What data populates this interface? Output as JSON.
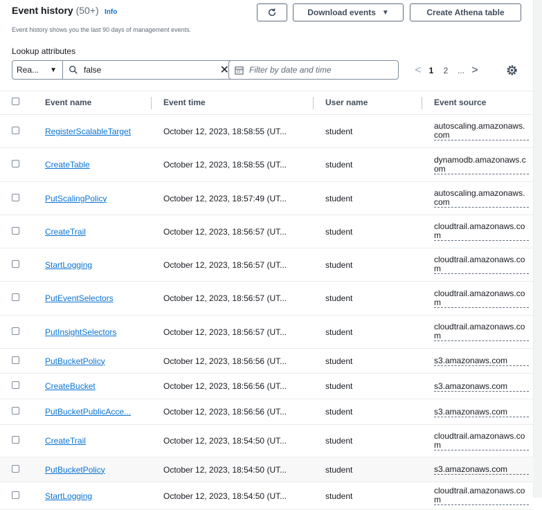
{
  "header": {
    "title": "Event history",
    "count": "(50+)",
    "info": "Info",
    "description": "Event history shows you the last 90 days of management events."
  },
  "toolbar": {
    "refresh_icon": "refresh-icon",
    "download_label": "Download events",
    "create_athena_label": "Create Athena table"
  },
  "lookup": {
    "label": "Lookup attributes",
    "attribute": "Rea...",
    "search_value": "false",
    "date_placeholder": "Filter by date and time"
  },
  "pagination": {
    "prev": "<",
    "pages": [
      "1",
      "2"
    ],
    "ellipsis": "...",
    "next": ">"
  },
  "table": {
    "columns": [
      "Event name",
      "Event time",
      "User name",
      "Event source"
    ],
    "rows": [
      {
        "name": "RegisterScalableTarget",
        "time": "October 12, 2023, 18:58:55 (UT...",
        "user": "student",
        "source": "autoscaling.amazonaws.com"
      },
      {
        "name": "CreateTable",
        "time": "October 12, 2023, 18:58:55 (UT...",
        "user": "student",
        "source": "dynamodb.amazonaws.com"
      },
      {
        "name": "PutScalingPolicy",
        "time": "October 12, 2023, 18:57:49 (UT...",
        "user": "student",
        "source": "autoscaling.amazonaws.com"
      },
      {
        "name": "CreateTrail",
        "time": "October 12, 2023, 18:56:57 (UT...",
        "user": "student",
        "source": "cloudtrail.amazonaws.com"
      },
      {
        "name": "StartLogging",
        "time": "October 12, 2023, 18:56:57 (UT...",
        "user": "student",
        "source": "cloudtrail.amazonaws.com"
      },
      {
        "name": "PutEventSelectors",
        "time": "October 12, 2023, 18:56:57 (UT...",
        "user": "student",
        "source": "cloudtrail.amazonaws.com"
      },
      {
        "name": "PutInsightSelectors",
        "time": "October 12, 2023, 18:56:57 (UT...",
        "user": "student",
        "source": "cloudtrail.amazonaws.com"
      },
      {
        "name": "PutBucketPolicy",
        "time": "October 12, 2023, 18:56:56 (UT...",
        "user": "student",
        "source": "s3.amazonaws.com"
      },
      {
        "name": "CreateBucket",
        "time": "October 12, 2023, 18:56:56 (UT...",
        "user": "student",
        "source": "s3.amazonaws.com"
      },
      {
        "name": "PutBucketPublicAcce...",
        "time": "October 12, 2023, 18:56:56 (UT...",
        "user": "student",
        "source": "s3.amazonaws.com"
      },
      {
        "name": "CreateTrail",
        "time": "October 12, 2023, 18:54:50 (UT...",
        "user": "student",
        "source": "cloudtrail.amazonaws.com"
      },
      {
        "name": "PutBucketPolicy",
        "time": "October 12, 2023, 18:54:50 (UT...",
        "user": "student",
        "source": "s3.amazonaws.com"
      },
      {
        "name": "StartLogging",
        "time": "October 12, 2023, 18:54:50 (UT...",
        "user": "student",
        "source": "cloudtrail.amazonaws.com"
      }
    ]
  },
  "colors": {
    "link": "#0972d3",
    "text": "#16191f",
    "muted": "#5f6b7a",
    "border": "#e9ebed"
  }
}
